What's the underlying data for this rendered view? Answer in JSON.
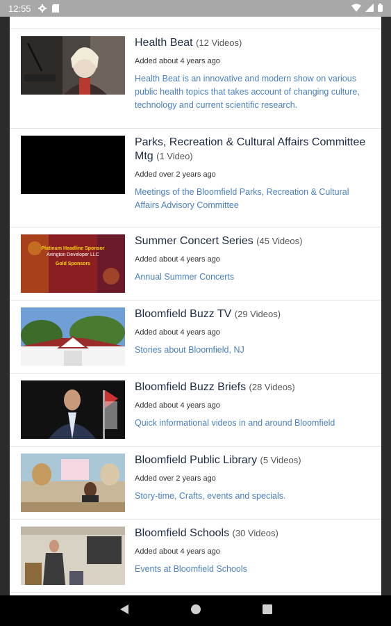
{
  "status": {
    "time": "12:55"
  },
  "channels": [
    {
      "title": "Health Beat",
      "count": "(12 Videos)",
      "added": "Added about 4 years ago",
      "description": "Health Beat is an innovative and modern show on various public health topics that takes account of changing culture, technology and current scientific research."
    },
    {
      "title": "Parks, Recreation & Cultural Affairs Committee Mtg",
      "count": "(1 Video)",
      "added": "Added over 2 years ago",
      "description": "Meetings of the Bloomfield Parks, Recreation & Cultural Affairs Advisory Committee"
    },
    {
      "title": "Summer Concert Series",
      "count": "(45 Videos)",
      "added": "Added about 4 years ago",
      "description": "Annual Summer Concerts",
      "thumb_text": [
        "Platinum Headline Sponsor",
        "Avington Developer LLC",
        "Gold Sponsors"
      ]
    },
    {
      "title": "Bloomfield Buzz TV",
      "count": "(29 Videos)",
      "added": "Added about 4 years ago",
      "description": "Stories about Bloomfield, NJ"
    },
    {
      "title": "Bloomfield Buzz Briefs",
      "count": "(28 Videos)",
      "added": "Added about 4 years ago",
      "description": "Quick informational videos in and around Bloomfield"
    },
    {
      "title": "Bloomfield Public Library",
      "count": "(5 Videos)",
      "added": "Added over 2 years ago",
      "description": "Story-time, Crafts, events and specials."
    },
    {
      "title": "Bloomfield Schools",
      "count": "(30 Videos)",
      "added": "Added about 4 years ago",
      "description": "Events at Bloomfield Schools"
    }
  ],
  "colors": {
    "title": "#1f2a44",
    "link": "#4a7fc1",
    "status_bar": "#a8a8a8",
    "nav_bar": "#000000"
  },
  "icons": [
    "gear-icon",
    "sd-card-icon",
    "wifi-icon",
    "signal-icon",
    "battery-icon",
    "back-icon",
    "home-icon",
    "recents-icon"
  ]
}
